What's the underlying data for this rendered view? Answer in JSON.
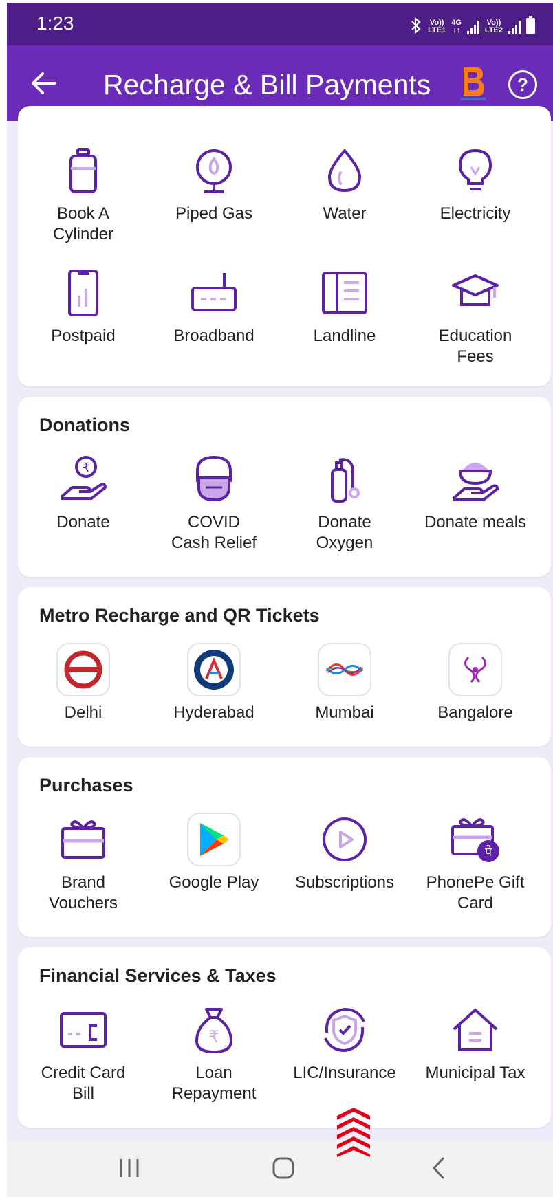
{
  "status_bar": {
    "time": "1:23",
    "sim1": "Vo)) LTE1",
    "net": "4G",
    "sim2": "Vo)) LTE2"
  },
  "app_bar": {
    "title": "Recharge & Bill Payments",
    "accent_color": "#6a2cb8",
    "help_label": "?"
  },
  "utilities": {
    "row1": [
      {
        "label": "Book A\nCylinder",
        "icon": "gas-cylinder-icon"
      },
      {
        "label": "Piped Gas",
        "icon": "piped-gas-icon"
      },
      {
        "label": "Water",
        "icon": "water-drop-icon"
      },
      {
        "label": "Electricity",
        "icon": "bulb-icon"
      }
    ],
    "row2": [
      {
        "label": "Postpaid",
        "icon": "postpaid-phone-icon"
      },
      {
        "label": "Broadband",
        "icon": "router-icon"
      },
      {
        "label": "Landline",
        "icon": "landline-icon"
      },
      {
        "label": "Education\nFees",
        "icon": "graduation-cap-icon"
      }
    ]
  },
  "donations": {
    "title": "Donations",
    "items": [
      {
        "label": "Donate",
        "icon": "donate-hand-icon"
      },
      {
        "label": "COVID\nCash Relief",
        "icon": "mask-face-icon"
      },
      {
        "label": "Donate\nOxygen",
        "icon": "oxygen-cylinder-icon"
      },
      {
        "label": "Donate meals",
        "icon": "meal-bowl-icon"
      }
    ]
  },
  "metro": {
    "title": "Metro Recharge and QR Tickets",
    "items": [
      {
        "label": "Delhi",
        "icon": "delhi-metro-logo-icon"
      },
      {
        "label": "Hyderabad",
        "icon": "hyderabad-metro-logo-icon"
      },
      {
        "label": "Mumbai",
        "icon": "mumbai-metro-logo-icon"
      },
      {
        "label": "Bangalore",
        "icon": "bangalore-metro-logo-icon"
      }
    ]
  },
  "purchases": {
    "title": "Purchases",
    "items": [
      {
        "label": "Brand\nVouchers",
        "icon": "gift-voucher-icon"
      },
      {
        "label": "Google Play",
        "icon": "google-play-icon"
      },
      {
        "label": "Subscriptions",
        "icon": "play-circle-icon"
      },
      {
        "label": "PhonePe Gift\nCard",
        "icon": "gift-card-icon"
      }
    ]
  },
  "financial": {
    "title": "Financial Services & Taxes",
    "items": [
      {
        "label": "Credit Card\nBill",
        "icon": "credit-card-icon"
      },
      {
        "label": "Loan\nRepayment",
        "icon": "money-bag-icon"
      },
      {
        "label": "LIC/Insurance",
        "icon": "shield-refresh-icon"
      },
      {
        "label": "Municipal Tax",
        "icon": "house-icon"
      }
    ]
  },
  "colors": {
    "icon": "#5b22a6",
    "icon_light": "#c9a7ea",
    "status_bar": "#4e1e87",
    "background": "#f0ebf8"
  }
}
